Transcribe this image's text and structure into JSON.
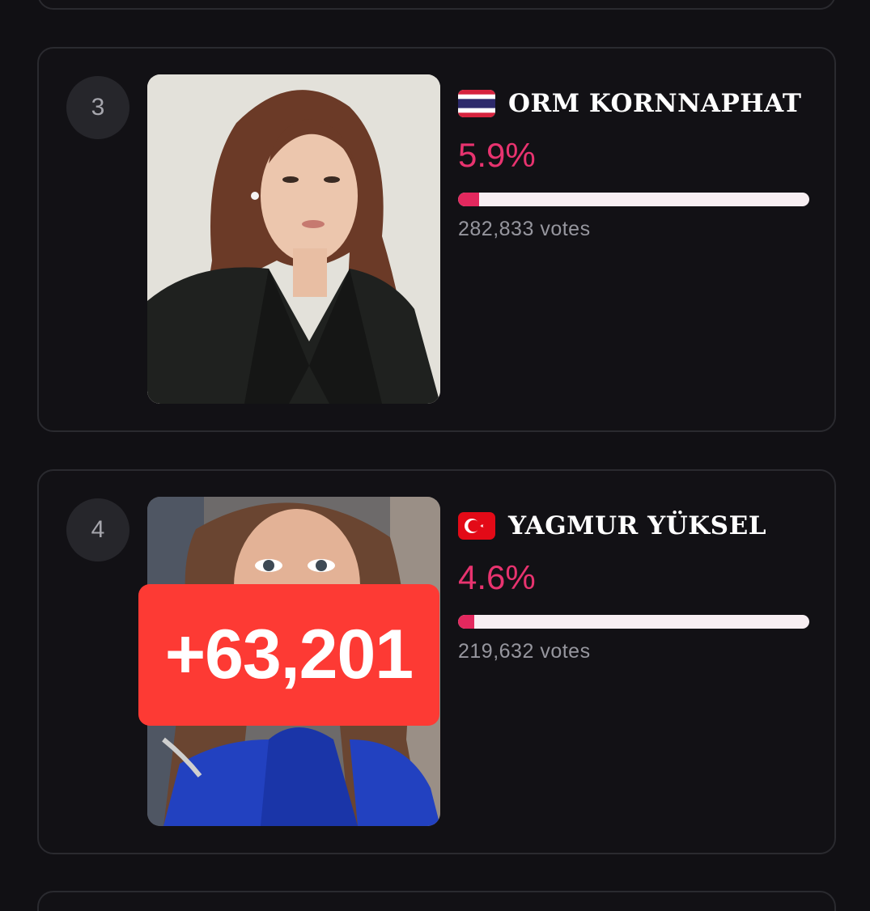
{
  "entries": [
    {
      "rank": "3",
      "name": "ORM KORNNAPHAT",
      "country_flag": "thailand-flag-icon",
      "percent": "5.9%",
      "percent_value": 5.9,
      "votes": "282,833 votes"
    },
    {
      "rank": "4",
      "name": "YAGMUR YÜKSEL",
      "country_flag": "turkey-flag-icon",
      "percent": "4.6%",
      "percent_value": 4.6,
      "votes": "219,632 votes",
      "overlay": "+63,201"
    }
  ],
  "colors": {
    "background": "#111014",
    "card_border": "#2a2a2f",
    "accent_pink": "#e8336f",
    "bar_track": "#f7eef2",
    "overlay_red": "#fd3a34"
  }
}
